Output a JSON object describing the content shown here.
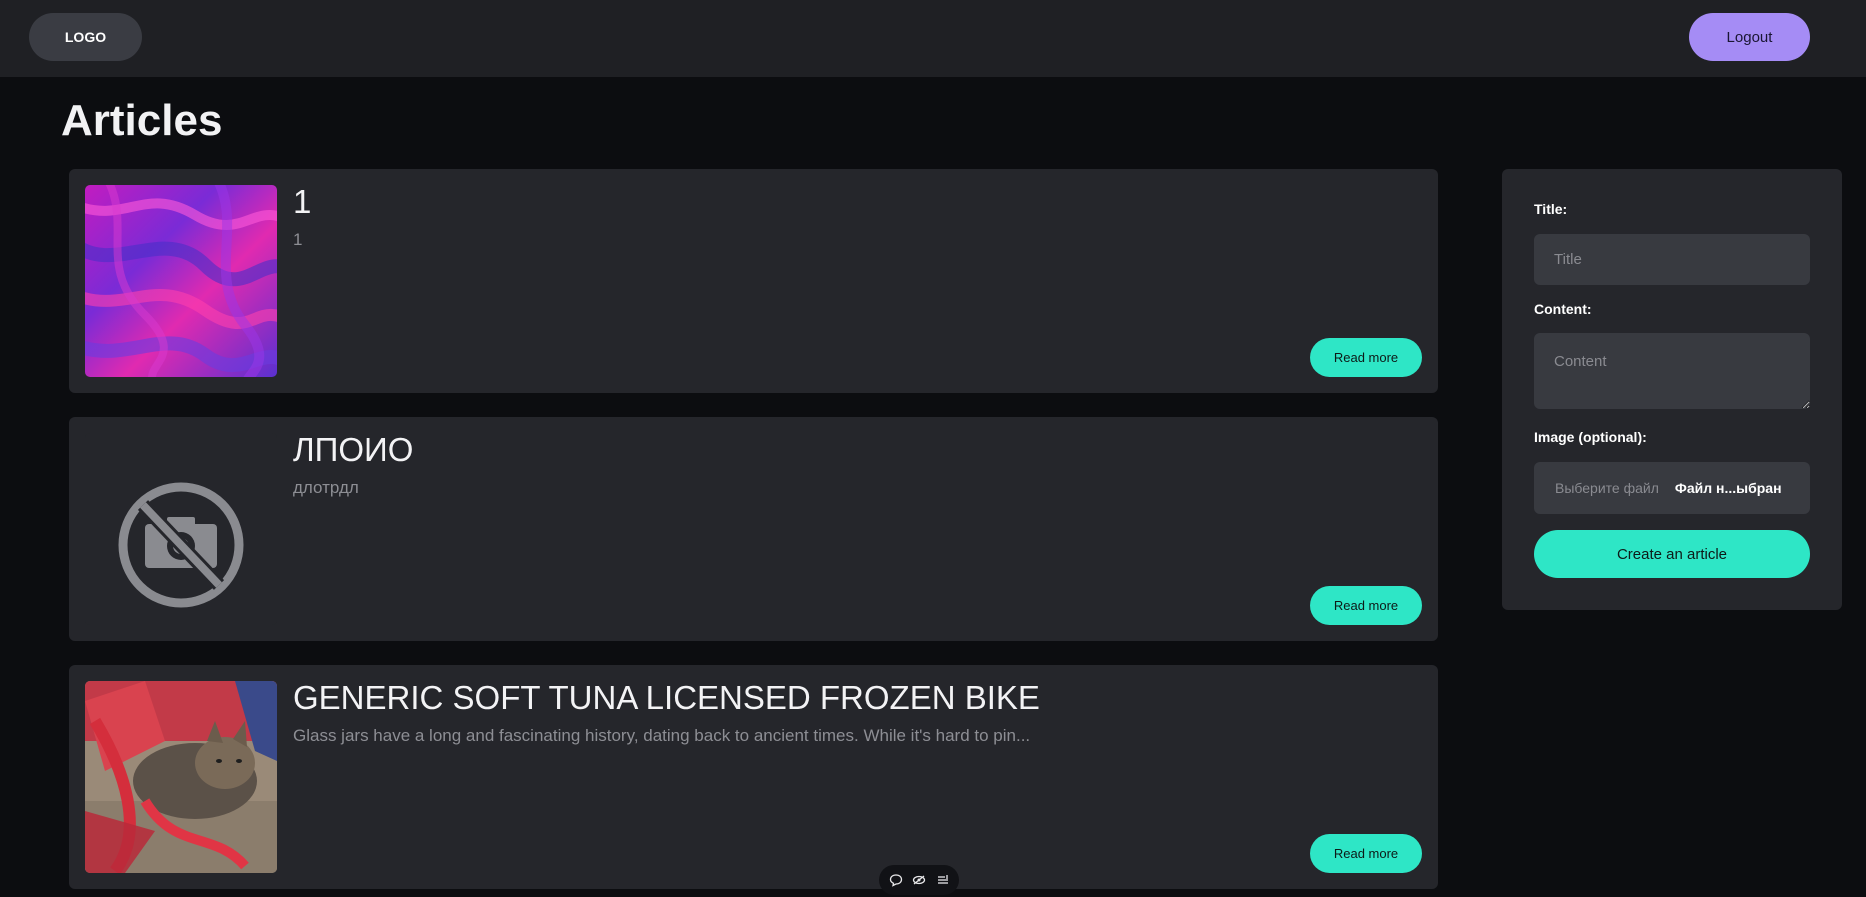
{
  "header": {
    "logo_label": "LOGO",
    "logout_label": "Logout"
  },
  "page": {
    "title": "Articles"
  },
  "articles": [
    {
      "title": "1",
      "excerpt": "1",
      "read_more_label": "Read more",
      "image": "abstract-purple-swirl"
    },
    {
      "title": "ЛПОИО",
      "excerpt": "длотрдл",
      "read_more_label": "Read more",
      "image": "no-image-placeholder-icon"
    },
    {
      "title": "GENERIC SOFT TUNA LICENSED FROZEN BIKE",
      "excerpt": "Glass jars have a long and fascinating history, dating back to ancient times. While it's hard to pin...",
      "read_more_label": "Read more",
      "image": "cat-in-red-bag-photo"
    }
  ],
  "form": {
    "title_label": "Title:",
    "title_placeholder": "Title",
    "content_label": "Content:",
    "content_placeholder": "Content",
    "image_label": "Image (optional):",
    "file_choose_label": "Выберите файл",
    "file_status": "Файл н...ыбран",
    "submit_label": "Create an article"
  },
  "colors": {
    "accent_teal": "#2ee6c6",
    "accent_purple": "#a58cf5",
    "card_bg": "#25262b",
    "page_bg": "#0c0d10"
  },
  "toolbar_icons": [
    "comment-icon",
    "eye-slash-icon",
    "list-settings-icon"
  ]
}
